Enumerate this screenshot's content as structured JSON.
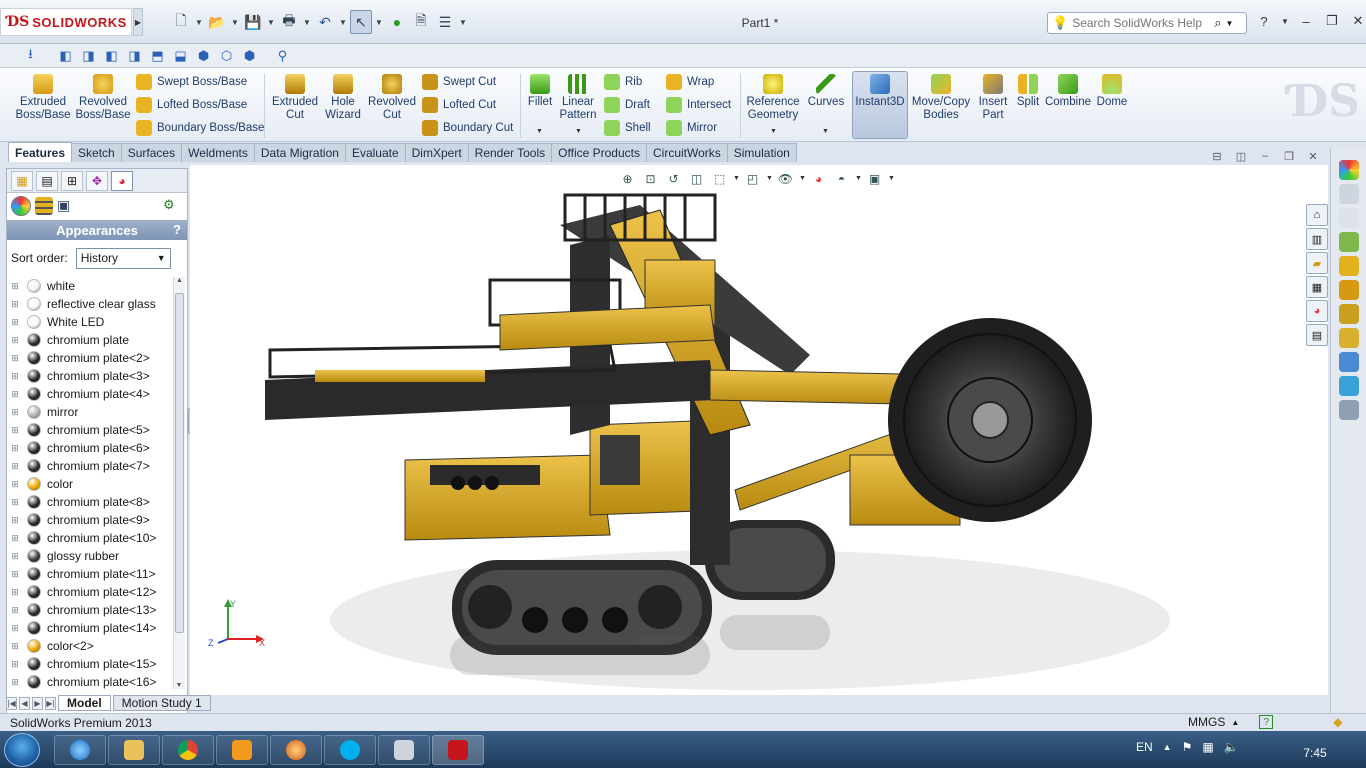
{
  "titlebar": {
    "logo_text": "SOLIDWORKS",
    "document_title": "Part1 *",
    "help_placeholder": "Search SolidWorks Help"
  },
  "ribbon": {
    "extruded_boss": "Extruded Boss/Base",
    "revolved_boss": "Revolved Boss/Base",
    "swept_boss": "Swept Boss/Base",
    "lofted_boss": "Lofted Boss/Base",
    "boundary_boss": "Boundary Boss/Base",
    "extruded_cut": "Extruded Cut",
    "hole_wizard": "Hole Wizard",
    "revolved_cut": "Revolved Cut",
    "swept_cut": "Swept Cut",
    "lofted_cut": "Lofted Cut",
    "boundary_cut": "Boundary Cut",
    "fillet": "Fillet",
    "linear_pattern": "Linear Pattern",
    "rib": "Rib",
    "draft": "Draft",
    "shell": "Shell",
    "wrap": "Wrap",
    "intersect": "Intersect",
    "mirror": "Mirror",
    "reference_geometry": "Reference Geometry",
    "curves": "Curves",
    "instant3d": "Instant3D",
    "move_copy": "Move/Copy Bodies",
    "insert_part": "Insert Part",
    "split": "Split",
    "combine": "Combine",
    "dome": "Dome"
  },
  "tabs": [
    "Features",
    "Sketch",
    "Surfaces",
    "Weldments",
    "Data Migration",
    "Evaluate",
    "DimXpert",
    "Render Tools",
    "Office Products",
    "CircuitWorks",
    "Simulation"
  ],
  "panel": {
    "header": "Appearances",
    "help": "?",
    "sort_label": "Sort order:",
    "sort_value": "History",
    "items": [
      {
        "label": "white",
        "color": "#f2f2f2"
      },
      {
        "label": "reflective clear glass",
        "color": "#f5f5f5"
      },
      {
        "label": "White LED",
        "color": "#f7f7f7"
      },
      {
        "label": "chromium plate",
        "color": "#2a2a2a"
      },
      {
        "label": "chromium plate<2>",
        "color": "#2a2a2a"
      },
      {
        "label": "chromium plate<3>",
        "color": "#2a2a2a"
      },
      {
        "label": "chromium plate<4>",
        "color": "#2a2a2a"
      },
      {
        "label": "mirror",
        "color": "#b0b0b0"
      },
      {
        "label": "chromium plate<5>",
        "color": "#2a2a2a"
      },
      {
        "label": "chromium plate<6>",
        "color": "#2a2a2a"
      },
      {
        "label": "chromium plate<7>",
        "color": "#2a2a2a"
      },
      {
        "label": "color",
        "color": "#f0a800"
      },
      {
        "label": "chromium plate<8>",
        "color": "#2a2a2a"
      },
      {
        "label": "chromium plate<9>",
        "color": "#2a2a2a"
      },
      {
        "label": "chromium plate<10>",
        "color": "#2a2a2a"
      },
      {
        "label": "glossy rubber",
        "color": "#3a3a3a"
      },
      {
        "label": "chromium plate<11>",
        "color": "#2a2a2a"
      },
      {
        "label": "chromium plate<12>",
        "color": "#2a2a2a"
      },
      {
        "label": "chromium plate<13>",
        "color": "#2a2a2a"
      },
      {
        "label": "chromium plate<14>",
        "color": "#2a2a2a"
      },
      {
        "label": "color<2>",
        "color": "#f0a800"
      },
      {
        "label": "chromium plate<15>",
        "color": "#2a2a2a"
      },
      {
        "label": "chromium plate<16>",
        "color": "#2a2a2a"
      }
    ]
  },
  "bottom_tabs": {
    "model": "Model",
    "motion": "Motion Study 1"
  },
  "triad": {
    "x": "X",
    "y": "Y",
    "z": "Z"
  },
  "status": {
    "product": "SolidWorks Premium 2013",
    "units": "MMGS"
  },
  "taskbar": {
    "lang": "EN",
    "clock": "7:45"
  },
  "colors": {
    "accent": "#c4161c",
    "machine_yellow": "#d9a81e",
    "machine_dark": "#2b2b2b"
  }
}
